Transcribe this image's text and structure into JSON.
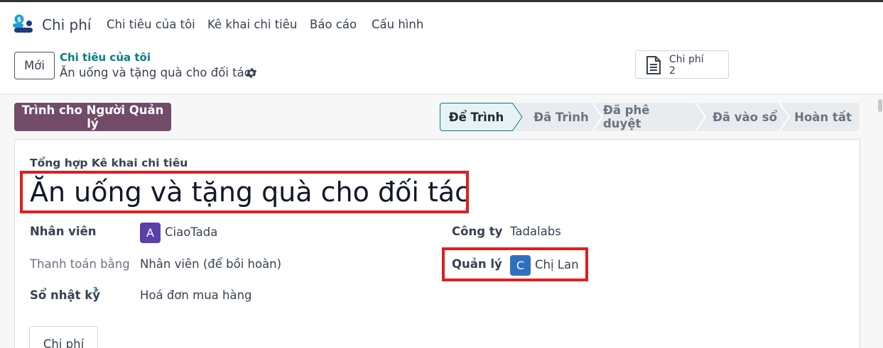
{
  "navbar": {
    "app_name": "Chi phí",
    "menu": [
      "Chi tiêu của tôi",
      "Kê khai chi tiêu",
      "Báo cáo",
      "Cấu hình"
    ]
  },
  "control_panel": {
    "new_button": "Mới",
    "breadcrumb_parent": "Chi tiêu của tôi",
    "breadcrumb_current": "Ăn uống và tặng quà cho đối tác",
    "smart_button": {
      "label": "Chi phí",
      "value": "2"
    }
  },
  "actions": {
    "submit_button": "Trình cho Người Quản lý"
  },
  "statusbar": {
    "stages": [
      "Để Trình",
      "Đã Trình",
      "Đã phê duyệt",
      "Đã vào sổ",
      "Hoàn tất"
    ],
    "active": "Để Trình"
  },
  "form": {
    "section_label": "Tổng hợp Kê khai chi tiêu",
    "title": "Ăn uống và tặng quà cho đối tác",
    "employee_label": "Nhân viên",
    "employee_avatar": "A",
    "employee_value": "CiaoTada",
    "payment_label": "Thanh toán bằng",
    "payment_value": "Nhân viên (để bồi hoàn)",
    "journal_label": "Sổ nhật ký",
    "journal_help": "?",
    "journal_value": "Hoá đơn mua hàng",
    "company_label": "Công ty",
    "company_value": "Tadalabs",
    "manager_label": "Quản lý",
    "manager_avatar": "C",
    "manager_value": "Chị Lan"
  },
  "tabs": [
    "Chi phí"
  ],
  "colors": {
    "primary": "#714b67",
    "accent": "#017e84",
    "highlight": "#e11d1d"
  }
}
